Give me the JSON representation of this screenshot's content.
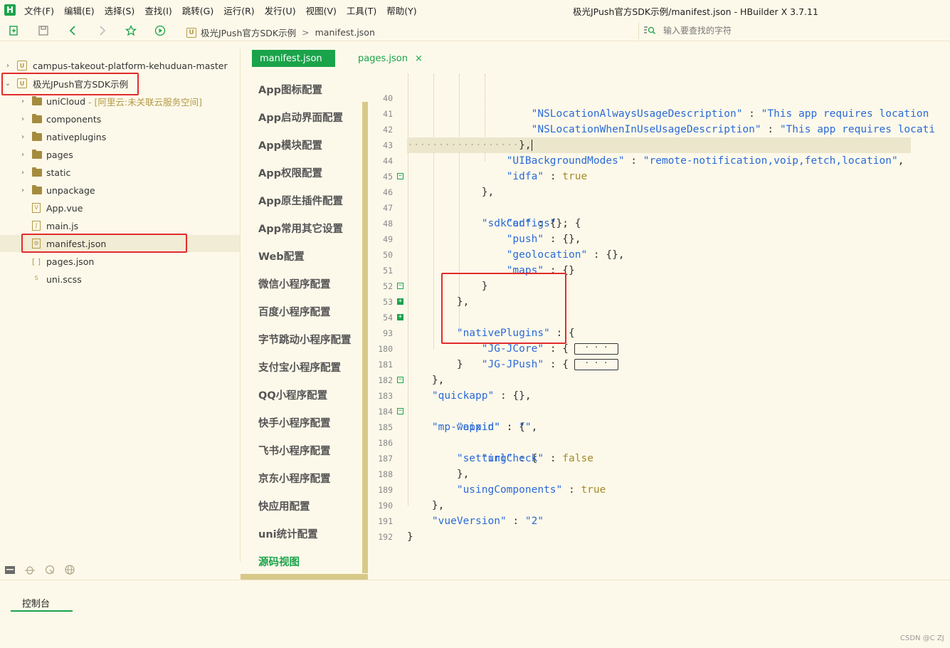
{
  "app": {
    "logo_text": "H",
    "window_title": "极光JPush官方SDK示例/manifest.json - HBuilder X 3.7.11"
  },
  "menu": [
    "文件(F)",
    "编辑(E)",
    "选择(S)",
    "查找(I)",
    "跳转(G)",
    "运行(R)",
    "发行(U)",
    "视图(V)",
    "工具(T)",
    "帮助(Y)"
  ],
  "toolbar": {
    "breadcrumb_project": "极光JPush官方SDK示例",
    "breadcrumb_sep": ">",
    "breadcrumb_file": "manifest.json",
    "search_placeholder": "输入要查找的字符"
  },
  "sidebar": {
    "items": [
      {
        "label": "campus-takeout-platform-kehuduan-master",
        "chevron": "›",
        "kind": "project"
      },
      {
        "label": "极光JPush官方SDK示例",
        "chevron": "⌄",
        "kind": "project"
      },
      {
        "label": "uniCloud",
        "note": "- [阿里云:未关联云服务空间]",
        "chevron": "›",
        "kind": "folder"
      },
      {
        "label": "components",
        "chevron": "›",
        "kind": "folder"
      },
      {
        "label": "nativeplugins",
        "chevron": "›",
        "kind": "folder"
      },
      {
        "label": "pages",
        "chevron": "›",
        "kind": "folder"
      },
      {
        "label": "static",
        "chevron": "›",
        "kind": "folder"
      },
      {
        "label": "unpackage",
        "chevron": "›",
        "kind": "folder"
      },
      {
        "label": "App.vue",
        "chevron": "",
        "kind": "file",
        "glyph": "V"
      },
      {
        "label": "main.js",
        "chevron": "",
        "kind": "file",
        "glyph": "J"
      },
      {
        "label": "manifest.json",
        "chevron": "",
        "kind": "file",
        "glyph": "⚙"
      },
      {
        "label": "pages.json",
        "chevron": "",
        "kind": "file",
        "glyph": "[ ]"
      },
      {
        "label": "uni.scss",
        "chevron": "",
        "kind": "file",
        "glyph": "S"
      }
    ]
  },
  "tabs": {
    "active": "manifest.json",
    "other": "pages.json",
    "close_glyph": "×"
  },
  "config_nav": [
    "App图标配置",
    "App启动界面配置",
    "App模块配置",
    "App权限配置",
    "App原生插件配置",
    "App常用其它设置",
    "Web配置",
    "微信小程序配置",
    "百度小程序配置",
    "字节跳动小程序配置",
    "支付宝小程序配置",
    "QQ小程序配置",
    "快手小程序配置",
    "飞书小程序配置",
    "京东小程序配置",
    "快应用配置",
    "uni统计配置",
    "源码视图"
  ],
  "code": {
    "line_numbers": [
      "40",
      "41",
      "42",
      "43",
      "44",
      "45",
      "46",
      "47",
      "48",
      "49",
      "50",
      "51",
      "52",
      "53",
      "54",
      "93",
      "180",
      "181",
      "182",
      "183",
      "184",
      "185",
      "186",
      "187",
      "188",
      "189",
      "190",
      "191",
      "192"
    ],
    "collapsed_placeholder": "· · ·"
  },
  "console": {
    "tab_label": "控制台"
  },
  "watermark": "CSDN @C ZJ",
  "colors": {
    "accent": "#1aa34a",
    "background": "#fdf9ea",
    "annotation": "#e22c2c",
    "string": "#2a6ad8",
    "boolean": "#a58a28"
  }
}
